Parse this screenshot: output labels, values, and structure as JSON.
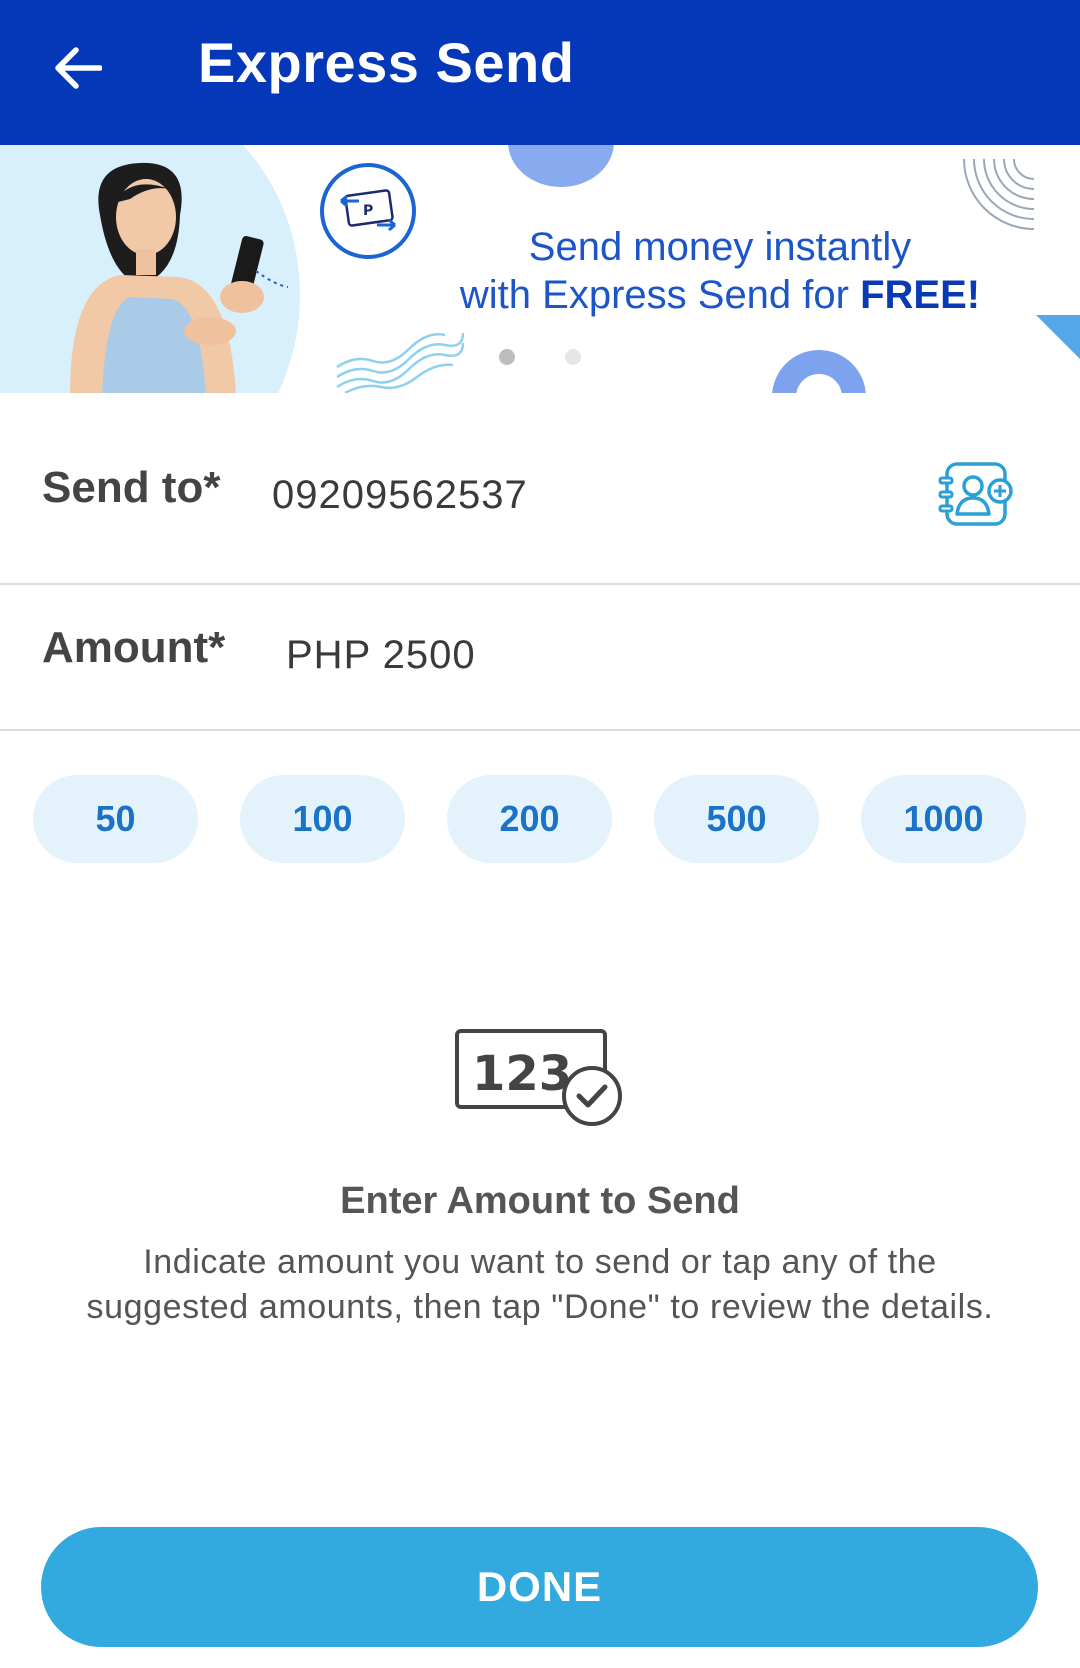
{
  "header": {
    "title": "Express Send",
    "back_icon": "arrow-left-icon",
    "background": "#0538b8"
  },
  "banner": {
    "line1": "Send money instantly",
    "line2_prefix": "with Express Send for ",
    "line2_emphasis": "FREE!",
    "slide_count": 2,
    "active_slide": 1,
    "text_color": "#1b55c8"
  },
  "form": {
    "send_to": {
      "label": "Send to*",
      "value": "09209562537",
      "action_icon": "contacts-add-icon"
    },
    "amount": {
      "label": "Amount*",
      "value": "PHP 2500"
    }
  },
  "suggested_amounts": [
    "50",
    "100",
    "200",
    "500",
    "1000"
  ],
  "info": {
    "icon": "amount-check-icon",
    "icon_text": "123",
    "heading": "Enter Amount to Send",
    "text": "Indicate amount you want to send or tap any of the suggested amounts, then tap \"Done\" to review the details."
  },
  "done_button": {
    "label": "DONE",
    "color": "#33aadf"
  }
}
